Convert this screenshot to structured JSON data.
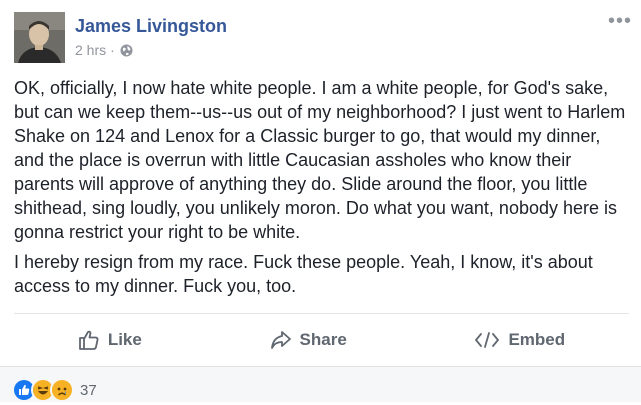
{
  "post": {
    "author": "James Livingston",
    "time": "2 hrs",
    "separator": "·",
    "privacy_icon": "globe-icon",
    "more_icon": "more-options-icon",
    "more_glyph": "•••",
    "paragraphs": [
      "OK, officially, I now hate white people. I am a white people, for God's sake, but can we keep them--us--us out of my neighborhood? I just went to Harlem Shake on 124 and Lenox for a Classic burger to go, that would my dinner, and the place is overrun with little Caucasian assholes who know their parents will approve of anything they do. Slide around the floor, you little shithead, sing loudly, you unlikely moron. Do what you want, nobody here is gonna restrict your right to be white.",
      "I hereby resign from my race. Fuck these people. Yeah, I know, it's about access to my dinner. Fuck you, too."
    ]
  },
  "actions": {
    "like_label": "Like",
    "share_label": "Share",
    "embed_label": "Embed"
  },
  "reactions": {
    "icons": [
      "like-reaction-icon",
      "haha-reaction-icon",
      "sad-reaction-icon"
    ],
    "count": "37"
  },
  "colors": {
    "author_blue": "#365899",
    "text": "#1d2129",
    "muted": "#90949c",
    "action_gray": "#606770",
    "like_blue": "#1877f2",
    "emoji_yellow": "#f7b125"
  }
}
